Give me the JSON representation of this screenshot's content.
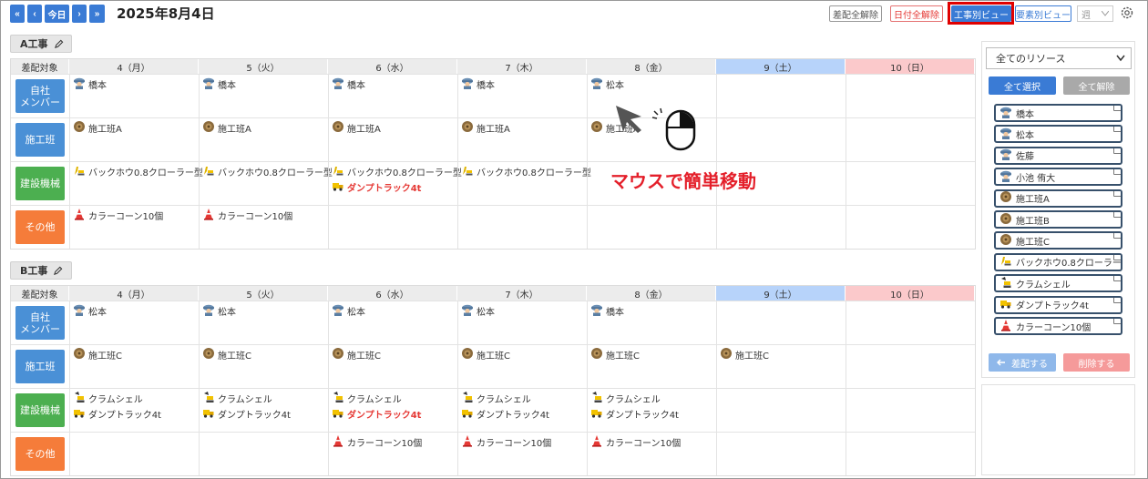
{
  "header": {
    "nav": {
      "first": "«",
      "prev": "‹",
      "today": "今日",
      "next": "›",
      "last": "»"
    },
    "date_title": "2025年8月4日",
    "btn_clear_assign": "差配全解除",
    "btn_clear_date": "日付全解除",
    "btn_project_view": "工事別ビュー",
    "btn_element_view": "要素別ビュー",
    "period_select": "週",
    "colors": {
      "accent": "#3a7bd5",
      "danger": "#e53935",
      "highlight_border": "#e00000"
    }
  },
  "grid_header": {
    "corner": "差配対象",
    "days": [
      "4（月）",
      "5（火）",
      "6（水）",
      "7（木）",
      "8（金）",
      "9（土）",
      "10（日）"
    ]
  },
  "projects": [
    {
      "name": "A工事",
      "rows": [
        {
          "category": "自社\nメンバー",
          "color": "blue",
          "cells": [
            [
              {
                "icon": "worker-icon",
                "text": "橋本"
              }
            ],
            [
              {
                "icon": "worker-icon",
                "text": "橋本"
              }
            ],
            [
              {
                "icon": "worker-icon",
                "text": "橋本"
              }
            ],
            [
              {
                "icon": "worker-icon",
                "text": "橋本"
              }
            ],
            [
              {
                "icon": "worker-icon",
                "text": "松本"
              }
            ],
            [],
            []
          ]
        },
        {
          "category": "施工班",
          "color": "blue",
          "cells": [
            [
              {
                "icon": "crew-icon",
                "text": "施工班A"
              }
            ],
            [
              {
                "icon": "crew-icon",
                "text": "施工班A"
              }
            ],
            [
              {
                "icon": "crew-icon",
                "text": "施工班A"
              }
            ],
            [
              {
                "icon": "crew-icon",
                "text": "施工班A"
              }
            ],
            [
              {
                "icon": "crew-icon",
                "text": "施工班A"
              }
            ],
            [],
            []
          ]
        },
        {
          "category": "建設機械",
          "color": "green",
          "cells": [
            [
              {
                "icon": "excavator-icon",
                "text": "バックホウ0.8クローラー型"
              }
            ],
            [
              {
                "icon": "excavator-icon",
                "text": "バックホウ0.8クローラー型"
              }
            ],
            [
              {
                "icon": "excavator-icon",
                "text": "バックホウ0.8クローラー型"
              },
              {
                "icon": "dump-truck-icon",
                "text": "ダンプトラック4t",
                "warn": true
              }
            ],
            [
              {
                "icon": "excavator-icon",
                "text": "バックホウ0.8クローラー型"
              }
            ],
            [],
            [],
            []
          ]
        },
        {
          "category": "その他",
          "color": "orange",
          "cells": [
            [
              {
                "icon": "traffic-cone-icon",
                "text": "カラーコーン10個"
              }
            ],
            [
              {
                "icon": "traffic-cone-icon",
                "text": "カラーコーン10個"
              }
            ],
            [],
            [],
            [],
            [],
            []
          ]
        }
      ]
    },
    {
      "name": "B工事",
      "rows": [
        {
          "category": "自社\nメンバー",
          "color": "blue",
          "cells": [
            [
              {
                "icon": "worker-icon",
                "text": "松本"
              }
            ],
            [
              {
                "icon": "worker-icon",
                "text": "松本"
              }
            ],
            [
              {
                "icon": "worker-icon",
                "text": "松本"
              }
            ],
            [
              {
                "icon": "worker-icon",
                "text": "松本"
              }
            ],
            [
              {
                "icon": "worker-icon",
                "text": "橋本"
              }
            ],
            [],
            []
          ]
        },
        {
          "category": "施工班",
          "color": "blue",
          "cells": [
            [
              {
                "icon": "crew-icon",
                "text": "施工班C"
              }
            ],
            [
              {
                "icon": "crew-icon",
                "text": "施工班C"
              }
            ],
            [
              {
                "icon": "crew-icon",
                "text": "施工班C"
              }
            ],
            [
              {
                "icon": "crew-icon",
                "text": "施工班C"
              }
            ],
            [
              {
                "icon": "crew-icon",
                "text": "施工班C"
              }
            ],
            [
              {
                "icon": "crew-icon",
                "text": "施工班C"
              }
            ],
            []
          ]
        },
        {
          "category": "建設機械",
          "color": "green",
          "cells": [
            [
              {
                "icon": "clamshell-icon",
                "text": "クラムシェル"
              },
              {
                "icon": "dump-truck-icon",
                "text": "ダンプトラック4t"
              }
            ],
            [
              {
                "icon": "clamshell-icon",
                "text": "クラムシェル"
              },
              {
                "icon": "dump-truck-icon",
                "text": "ダンプトラック4t"
              }
            ],
            [
              {
                "icon": "clamshell-icon",
                "text": "クラムシェル"
              },
              {
                "icon": "dump-truck-icon",
                "text": "ダンプトラック4t",
                "warn": true
              }
            ],
            [
              {
                "icon": "clamshell-icon",
                "text": "クラムシェル"
              },
              {
                "icon": "dump-truck-icon",
                "text": "ダンプトラック4t"
              }
            ],
            [
              {
                "icon": "clamshell-icon",
                "text": "クラムシェル"
              },
              {
                "icon": "dump-truck-icon",
                "text": "ダンプトラック4t"
              }
            ],
            [],
            []
          ]
        },
        {
          "category": "その他",
          "color": "orange",
          "cells": [
            [],
            [],
            [
              {
                "icon": "traffic-cone-icon",
                "text": "カラーコーン10個"
              }
            ],
            [
              {
                "icon": "traffic-cone-icon",
                "text": "カラーコーン10個"
              }
            ],
            [
              {
                "icon": "traffic-cone-icon",
                "text": "カラーコーン10個"
              }
            ],
            [],
            []
          ]
        }
      ]
    }
  ],
  "resource_panel": {
    "filter": "全てのリソース",
    "select_all": "全て選択",
    "deselect_all": "全て解除",
    "items": [
      {
        "icon": "worker-icon",
        "text": "橋本"
      },
      {
        "icon": "worker-icon",
        "text": "松本"
      },
      {
        "icon": "worker-icon",
        "text": "佐藤"
      },
      {
        "icon": "worker-icon",
        "text": "小池 侑大"
      },
      {
        "icon": "crew-icon",
        "text": "施工班A"
      },
      {
        "icon": "crew-icon",
        "text": "施工班B"
      },
      {
        "icon": "crew-icon",
        "text": "施工班C"
      },
      {
        "icon": "excavator-icon",
        "text": "バックホウ0.8クローラー型"
      },
      {
        "icon": "clamshell-icon",
        "text": "クラムシェル"
      },
      {
        "icon": "dump-truck-icon",
        "text": "ダンプトラック4t"
      },
      {
        "icon": "traffic-cone-icon",
        "text": "カラーコーン10個"
      }
    ],
    "assign_btn": "差配する",
    "remove_btn": "削除する"
  },
  "overlay": {
    "caption": "マウスで簡単移動"
  }
}
